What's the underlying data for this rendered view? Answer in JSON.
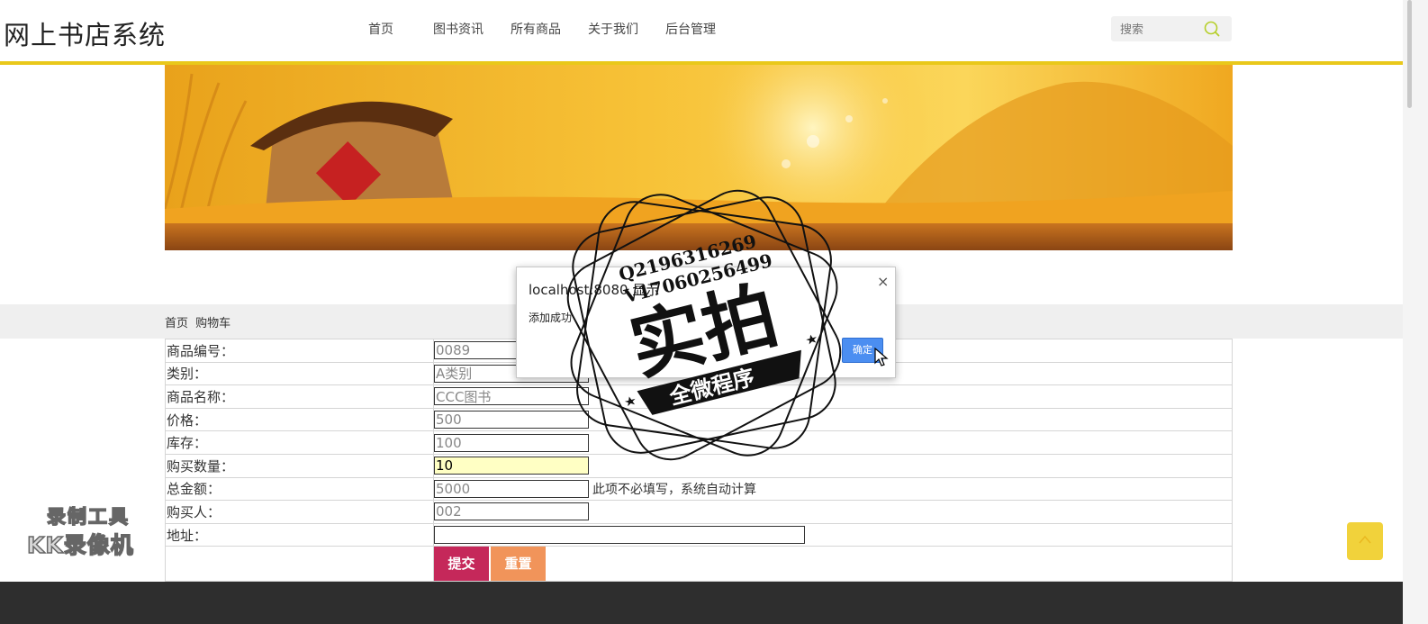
{
  "header": {
    "logo": "网上书店系统",
    "nav": [
      "首页",
      "图书资讯",
      "所有商品",
      "关于我们",
      "后台管理"
    ],
    "search_placeholder": "搜索"
  },
  "breadcrumb": {
    "home": "首页",
    "current": "购物车"
  },
  "form": {
    "fields": [
      {
        "label": "商品编号：",
        "value": "0089"
      },
      {
        "label": "类别：",
        "value": "A类别"
      },
      {
        "label": "商品名称：",
        "value": "CCC图书"
      },
      {
        "label": "价格：",
        "value": "500"
      },
      {
        "label": "库存：",
        "value": "100"
      },
      {
        "label": "购买数量：",
        "value": "10"
      },
      {
        "label": "总金额：",
        "value": "5000",
        "hint": "此项不必填写，系统自动计算"
      },
      {
        "label": "购买人：",
        "value": "002"
      },
      {
        "label": "地址：",
        "value": ""
      }
    ],
    "submit_label": "提交",
    "reset_label": "重置"
  },
  "dialog": {
    "title": "localhost:8080 显示",
    "message": "添加成功",
    "ok_label": "确定",
    "close_symbol": "×"
  },
  "watermark": {
    "stamp_lines": [
      "Q2196316269",
      "V17060256499"
    ],
    "stamp_main": "实拍",
    "stamp_ribbon": "全微程序",
    "recorder_line1": "录制工具",
    "recorder_line2": "KK录像机"
  },
  "colors": {
    "header_accent": "#e9c81a",
    "submit": "#c5285a",
    "reset": "#f1945a",
    "active_input": "#ffffc4",
    "dialog_ok": "#4b8ef1",
    "footer": "#2e2e2e",
    "back_top": "#f1d23b"
  }
}
